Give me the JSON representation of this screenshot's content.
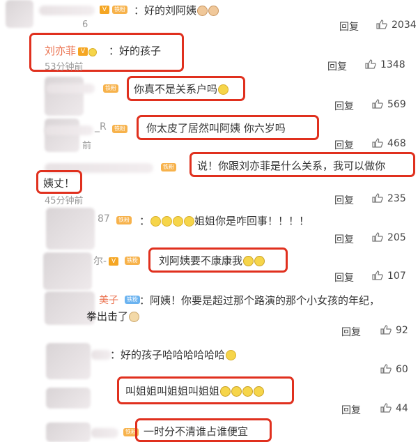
{
  "comments": [
    {
      "text": "：好的刘阿姨",
      "name_fragment": "",
      "time_fragment": "6",
      "reply": "回复",
      "likes": "2034"
    },
    {
      "name": "刘亦菲",
      "text": "：好的孩子",
      "time": "53分钟前",
      "reply": "回复",
      "likes": "1348"
    },
    {
      "text": "你真不是关系户吗",
      "reply": "回复",
      "likes": "569"
    },
    {
      "name_fragment": "_R",
      "text": "你太皮了居然叫阿姨 你六岁吗",
      "time_fragment": "前",
      "reply": "回复",
      "likes": "468"
    },
    {
      "text_line1": "说！你跟刘亦菲是什么关系，我可以做你",
      "text_line2": "姨丈！",
      "time": "45分钟前",
      "reply": "回复",
      "likes": "235"
    },
    {
      "name_fragment": "87",
      "text": "姐姐你是咋回事！！！！",
      "reply": "回复",
      "likes": "205"
    },
    {
      "name_fragment": "尔-",
      "text": "刘阿姨要不康康我",
      "reply": "回复",
      "likes": "107"
    },
    {
      "name_fragment": "美子",
      "text_line1": "：阿姨！你要是超过那个路演的那个小女孩的年纪，",
      "text_line2": "拳出击了",
      "reply": "回复",
      "likes": "92"
    },
    {
      "text": "：好的孩子哈哈哈哈哈哈",
      "reply": "回复",
      "likes": "60"
    },
    {
      "text": "叫姐姐叫姐姐叫姐姐",
      "reply": "回复",
      "likes": "44"
    },
    {
      "text": "一时分不清谁占谁便宜"
    }
  ],
  "badges": {
    "fan": "铁粉",
    "vip": "V"
  },
  "colors": {
    "highlight": "#e0301e",
    "name": "#eb7350"
  },
  "icons": {
    "like": "thumbs-up-icon"
  }
}
